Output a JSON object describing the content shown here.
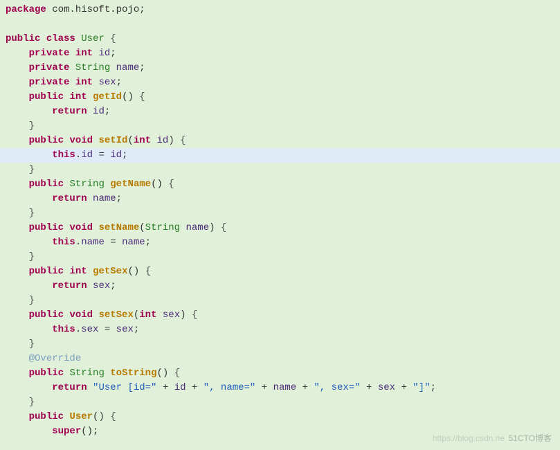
{
  "code": {
    "lines": [
      {
        "hl": false,
        "tokens": [
          {
            "c": "kw",
            "t": "package"
          },
          {
            "c": "",
            "t": " "
          },
          {
            "c": "pkg",
            "t": "com.hisoft.pojo"
          },
          {
            "c": "punct",
            "t": ";"
          }
        ]
      },
      {
        "hl": false,
        "tokens": []
      },
      {
        "hl": false,
        "tokens": [
          {
            "c": "kw",
            "t": "public"
          },
          {
            "c": "",
            "t": " "
          },
          {
            "c": "kw",
            "t": "class"
          },
          {
            "c": "",
            "t": " "
          },
          {
            "c": "type",
            "t": "User"
          },
          {
            "c": "",
            "t": " "
          },
          {
            "c": "brace",
            "t": "{"
          }
        ]
      },
      {
        "hl": false,
        "tokens": [
          {
            "c": "",
            "t": "    "
          },
          {
            "c": "kw",
            "t": "private"
          },
          {
            "c": "",
            "t": " "
          },
          {
            "c": "kw",
            "t": "int"
          },
          {
            "c": "",
            "t": " "
          },
          {
            "c": "var",
            "t": "id"
          },
          {
            "c": "punct",
            "t": ";"
          }
        ]
      },
      {
        "hl": false,
        "tokens": [
          {
            "c": "",
            "t": "    "
          },
          {
            "c": "kw",
            "t": "private"
          },
          {
            "c": "",
            "t": " "
          },
          {
            "c": "type",
            "t": "String"
          },
          {
            "c": "",
            "t": " "
          },
          {
            "c": "var",
            "t": "name"
          },
          {
            "c": "punct",
            "t": ";"
          }
        ]
      },
      {
        "hl": false,
        "tokens": [
          {
            "c": "",
            "t": "    "
          },
          {
            "c": "kw",
            "t": "private"
          },
          {
            "c": "",
            "t": " "
          },
          {
            "c": "kw",
            "t": "int"
          },
          {
            "c": "",
            "t": " "
          },
          {
            "c": "var",
            "t": "sex"
          },
          {
            "c": "punct",
            "t": ";"
          }
        ]
      },
      {
        "hl": false,
        "tokens": [
          {
            "c": "",
            "t": "    "
          },
          {
            "c": "kw",
            "t": "public"
          },
          {
            "c": "",
            "t": " "
          },
          {
            "c": "kw",
            "t": "int"
          },
          {
            "c": "",
            "t": " "
          },
          {
            "c": "method",
            "t": "getId"
          },
          {
            "c": "punct",
            "t": "()"
          },
          {
            "c": "",
            "t": " "
          },
          {
            "c": "brace",
            "t": "{"
          }
        ]
      },
      {
        "hl": false,
        "tokens": [
          {
            "c": "",
            "t": "        "
          },
          {
            "c": "kw",
            "t": "return"
          },
          {
            "c": "",
            "t": " "
          },
          {
            "c": "var",
            "t": "id"
          },
          {
            "c": "punct",
            "t": ";"
          }
        ]
      },
      {
        "hl": false,
        "tokens": [
          {
            "c": "",
            "t": "    "
          },
          {
            "c": "brace",
            "t": "}"
          }
        ]
      },
      {
        "hl": false,
        "tokens": [
          {
            "c": "",
            "t": "    "
          },
          {
            "c": "kw",
            "t": "public"
          },
          {
            "c": "",
            "t": " "
          },
          {
            "c": "kw",
            "t": "void"
          },
          {
            "c": "",
            "t": " "
          },
          {
            "c": "method",
            "t": "setId"
          },
          {
            "c": "punct",
            "t": "("
          },
          {
            "c": "kw",
            "t": "int"
          },
          {
            "c": "",
            "t": " "
          },
          {
            "c": "var",
            "t": "id"
          },
          {
            "c": "punct",
            "t": ")"
          },
          {
            "c": "",
            "t": " "
          },
          {
            "c": "brace",
            "t": "{"
          }
        ]
      },
      {
        "hl": true,
        "tokens": [
          {
            "c": "",
            "t": "        "
          },
          {
            "c": "kw",
            "t": "this"
          },
          {
            "c": "punct",
            "t": "."
          },
          {
            "c": "var",
            "t": "id"
          },
          {
            "c": "",
            "t": " "
          },
          {
            "c": "punct",
            "t": "="
          },
          {
            "c": "",
            "t": " "
          },
          {
            "c": "var",
            "t": "id"
          },
          {
            "c": "punct",
            "t": ";"
          }
        ]
      },
      {
        "hl": false,
        "tokens": [
          {
            "c": "",
            "t": "    "
          },
          {
            "c": "brace",
            "t": "}"
          }
        ]
      },
      {
        "hl": false,
        "tokens": [
          {
            "c": "",
            "t": "    "
          },
          {
            "c": "kw",
            "t": "public"
          },
          {
            "c": "",
            "t": " "
          },
          {
            "c": "type",
            "t": "String"
          },
          {
            "c": "",
            "t": " "
          },
          {
            "c": "method",
            "t": "getName"
          },
          {
            "c": "punct",
            "t": "()"
          },
          {
            "c": "",
            "t": " "
          },
          {
            "c": "brace",
            "t": "{"
          }
        ]
      },
      {
        "hl": false,
        "tokens": [
          {
            "c": "",
            "t": "        "
          },
          {
            "c": "kw",
            "t": "return"
          },
          {
            "c": "",
            "t": " "
          },
          {
            "c": "var",
            "t": "name"
          },
          {
            "c": "punct",
            "t": ";"
          }
        ]
      },
      {
        "hl": false,
        "tokens": [
          {
            "c": "",
            "t": "    "
          },
          {
            "c": "brace",
            "t": "}"
          }
        ]
      },
      {
        "hl": false,
        "tokens": [
          {
            "c": "",
            "t": "    "
          },
          {
            "c": "kw",
            "t": "public"
          },
          {
            "c": "",
            "t": " "
          },
          {
            "c": "kw",
            "t": "void"
          },
          {
            "c": "",
            "t": " "
          },
          {
            "c": "method",
            "t": "setName"
          },
          {
            "c": "punct",
            "t": "("
          },
          {
            "c": "type",
            "t": "String"
          },
          {
            "c": "",
            "t": " "
          },
          {
            "c": "var",
            "t": "name"
          },
          {
            "c": "punct",
            "t": ")"
          },
          {
            "c": "",
            "t": " "
          },
          {
            "c": "brace",
            "t": "{"
          }
        ]
      },
      {
        "hl": false,
        "tokens": [
          {
            "c": "",
            "t": "        "
          },
          {
            "c": "kw",
            "t": "this"
          },
          {
            "c": "punct",
            "t": "."
          },
          {
            "c": "var",
            "t": "name"
          },
          {
            "c": "",
            "t": " "
          },
          {
            "c": "punct",
            "t": "="
          },
          {
            "c": "",
            "t": " "
          },
          {
            "c": "var",
            "t": "name"
          },
          {
            "c": "punct",
            "t": ";"
          }
        ]
      },
      {
        "hl": false,
        "tokens": [
          {
            "c": "",
            "t": "    "
          },
          {
            "c": "brace",
            "t": "}"
          }
        ]
      },
      {
        "hl": false,
        "tokens": [
          {
            "c": "",
            "t": "    "
          },
          {
            "c": "kw",
            "t": "public"
          },
          {
            "c": "",
            "t": " "
          },
          {
            "c": "kw",
            "t": "int"
          },
          {
            "c": "",
            "t": " "
          },
          {
            "c": "method",
            "t": "getSex"
          },
          {
            "c": "punct",
            "t": "()"
          },
          {
            "c": "",
            "t": " "
          },
          {
            "c": "brace",
            "t": "{"
          }
        ]
      },
      {
        "hl": false,
        "tokens": [
          {
            "c": "",
            "t": "        "
          },
          {
            "c": "kw",
            "t": "return"
          },
          {
            "c": "",
            "t": " "
          },
          {
            "c": "var",
            "t": "sex"
          },
          {
            "c": "punct",
            "t": ";"
          }
        ]
      },
      {
        "hl": false,
        "tokens": [
          {
            "c": "",
            "t": "    "
          },
          {
            "c": "brace",
            "t": "}"
          }
        ]
      },
      {
        "hl": false,
        "tokens": [
          {
            "c": "",
            "t": "    "
          },
          {
            "c": "kw",
            "t": "public"
          },
          {
            "c": "",
            "t": " "
          },
          {
            "c": "kw",
            "t": "void"
          },
          {
            "c": "",
            "t": " "
          },
          {
            "c": "method",
            "t": "setSex"
          },
          {
            "c": "punct",
            "t": "("
          },
          {
            "c": "kw",
            "t": "int"
          },
          {
            "c": "",
            "t": " "
          },
          {
            "c": "var",
            "t": "sex"
          },
          {
            "c": "punct",
            "t": ")"
          },
          {
            "c": "",
            "t": " "
          },
          {
            "c": "brace",
            "t": "{"
          }
        ]
      },
      {
        "hl": false,
        "tokens": [
          {
            "c": "",
            "t": "        "
          },
          {
            "c": "kw",
            "t": "this"
          },
          {
            "c": "punct",
            "t": "."
          },
          {
            "c": "var",
            "t": "sex"
          },
          {
            "c": "",
            "t": " "
          },
          {
            "c": "punct",
            "t": "="
          },
          {
            "c": "",
            "t": " "
          },
          {
            "c": "var",
            "t": "sex"
          },
          {
            "c": "punct",
            "t": ";"
          }
        ]
      },
      {
        "hl": false,
        "tokens": [
          {
            "c": "",
            "t": "    "
          },
          {
            "c": "brace",
            "t": "}"
          }
        ]
      },
      {
        "hl": false,
        "tokens": [
          {
            "c": "",
            "t": "    "
          },
          {
            "c": "ann",
            "t": "@Override"
          }
        ]
      },
      {
        "hl": false,
        "tokens": [
          {
            "c": "",
            "t": "    "
          },
          {
            "c": "kw",
            "t": "public"
          },
          {
            "c": "",
            "t": " "
          },
          {
            "c": "type",
            "t": "String"
          },
          {
            "c": "",
            "t": " "
          },
          {
            "c": "method",
            "t": "toString"
          },
          {
            "c": "punct",
            "t": "()"
          },
          {
            "c": "",
            "t": " "
          },
          {
            "c": "brace",
            "t": "{"
          }
        ]
      },
      {
        "hl": false,
        "tokens": [
          {
            "c": "",
            "t": "        "
          },
          {
            "c": "kw",
            "t": "return"
          },
          {
            "c": "",
            "t": " "
          },
          {
            "c": "str",
            "t": "\"User [id=\""
          },
          {
            "c": "",
            "t": " "
          },
          {
            "c": "punct",
            "t": "+"
          },
          {
            "c": "",
            "t": " "
          },
          {
            "c": "var",
            "t": "id"
          },
          {
            "c": "",
            "t": " "
          },
          {
            "c": "punct",
            "t": "+"
          },
          {
            "c": "",
            "t": " "
          },
          {
            "c": "str",
            "t": "\", name=\""
          },
          {
            "c": "",
            "t": " "
          },
          {
            "c": "punct",
            "t": "+"
          },
          {
            "c": "",
            "t": " "
          },
          {
            "c": "var",
            "t": "name"
          },
          {
            "c": "",
            "t": " "
          },
          {
            "c": "punct",
            "t": "+"
          },
          {
            "c": "",
            "t": " "
          },
          {
            "c": "str",
            "t": "\", sex=\""
          },
          {
            "c": "",
            "t": " "
          },
          {
            "c": "punct",
            "t": "+"
          },
          {
            "c": "",
            "t": " "
          },
          {
            "c": "var",
            "t": "sex"
          },
          {
            "c": "",
            "t": " "
          },
          {
            "c": "punct",
            "t": "+"
          },
          {
            "c": "",
            "t": " "
          },
          {
            "c": "str",
            "t": "\"]\""
          },
          {
            "c": "punct",
            "t": ";"
          }
        ]
      },
      {
        "hl": false,
        "tokens": [
          {
            "c": "",
            "t": "    "
          },
          {
            "c": "brace",
            "t": "}"
          }
        ]
      },
      {
        "hl": false,
        "tokens": [
          {
            "c": "",
            "t": "    "
          },
          {
            "c": "kw",
            "t": "public"
          },
          {
            "c": "",
            "t": " "
          },
          {
            "c": "method",
            "t": "User"
          },
          {
            "c": "punct",
            "t": "()"
          },
          {
            "c": "",
            "t": " "
          },
          {
            "c": "brace",
            "t": "{"
          }
        ]
      },
      {
        "hl": false,
        "tokens": [
          {
            "c": "",
            "t": "        "
          },
          {
            "c": "kw",
            "t": "super"
          },
          {
            "c": "punct",
            "t": "();"
          }
        ]
      }
    ]
  },
  "watermark1": "51CTO博客",
  "watermark2": "https://blog.csdn.ne"
}
